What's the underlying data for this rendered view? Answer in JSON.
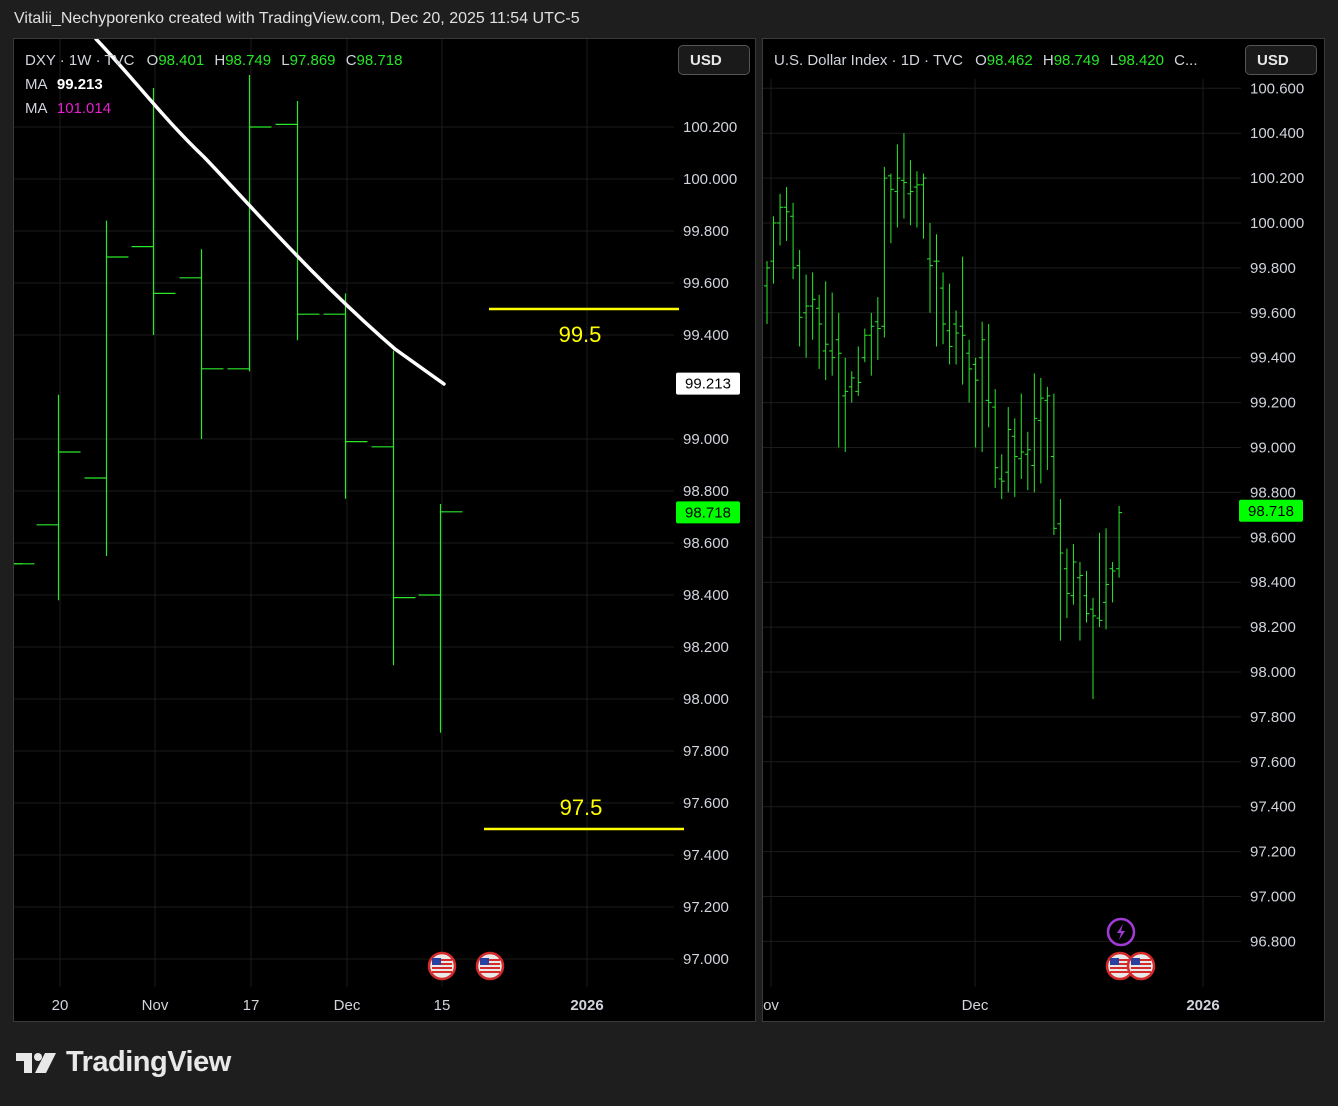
{
  "header": {
    "credit": "Vitalii_Nechyporenko created with TradingView.com, Dec 20, 2025 11:54 UTC-5"
  },
  "brand": {
    "name": "TradingView",
    "logo_icon": "tradingview-logo-icon"
  },
  "colors": {
    "bar": "#2be82b",
    "price_tag": "#00ff00",
    "ma_white": "#ffffff",
    "ma_magenta": "#e81ed0",
    "level_line": "#ffff00",
    "pane_bg": "#000000",
    "grid": "#1c1c1c"
  },
  "left_chart": {
    "legend": {
      "symbol": "DXY · 1W · TVC",
      "o_label": "O",
      "o_value": "98.401",
      "h_label": "H",
      "h_value": "98.749",
      "l_label": "L",
      "l_value": "97.869",
      "c_label": "C",
      "c_value": "98.718",
      "ma1_label": "MA",
      "ma1_value": "99.213",
      "ma2_label": "MA",
      "ma2_value": "101.014"
    },
    "currency_button": "USD",
    "ma_tag": "99.213",
    "price_tag": "98.718",
    "levels": [
      {
        "label": "99.5"
      },
      {
        "label": "97.5"
      }
    ],
    "x_labels": [
      "20",
      "Nov",
      "17",
      "Dec",
      "15",
      "2026"
    ],
    "event_icons": [
      "us-flag-icon",
      "us-flag-icon"
    ]
  },
  "right_chart": {
    "legend": {
      "symbol": "U.S. Dollar Index · 1D · TVC",
      "o_label": "O",
      "o_value": "98.462",
      "h_label": "H",
      "h_value": "98.749",
      "l_label": "L",
      "l_value": "98.420",
      "c_label": "C..."
    },
    "currency_button": "USD",
    "price_tag": "98.718",
    "x_labels": [
      "ov",
      "Dec",
      "2026"
    ],
    "event_icons": [
      "lightning-icon",
      "us-flag-icon",
      "us-flag-icon"
    ]
  },
  "chart_data": [
    {
      "type": "ohlc",
      "title": "DXY · 1W · TVC",
      "y_ticks": [
        "100.200",
        "100.000",
        "99.800",
        "99.600",
        "99.400",
        "99.000",
        "98.800",
        "98.600",
        "98.400",
        "98.200",
        "98.000",
        "97.800",
        "97.600",
        "97.400",
        "97.200",
        "97.000"
      ],
      "ylim": [
        96.9,
        100.4
      ],
      "bars": [
        {
          "o": 98.52,
          "h": 98.52,
          "l": 98.52,
          "c": 98.52
        },
        {
          "o": 98.67,
          "h": 99.17,
          "l": 98.38,
          "c": 98.95
        },
        {
          "o": 98.85,
          "h": 99.84,
          "l": 98.55,
          "c": 99.7
        },
        {
          "o": 99.74,
          "h": 100.35,
          "l": 99.4,
          "c": 99.56
        },
        {
          "o": 99.62,
          "h": 99.73,
          "l": 99.0,
          "c": 99.27
        },
        {
          "o": 99.27,
          "h": 100.4,
          "l": 99.26,
          "c": 100.2
        },
        {
          "o": 100.21,
          "h": 100.3,
          "l": 99.38,
          "c": 99.48
        },
        {
          "o": 99.48,
          "h": 99.56,
          "l": 98.77,
          "c": 98.99
        },
        {
          "o": 98.97,
          "h": 99.34,
          "l": 98.13,
          "c": 98.39
        },
        {
          "o": 98.4,
          "h": 98.75,
          "l": 97.87,
          "c": 98.72
        }
      ],
      "ma_series": [
        {
          "name": "MA",
          "value": "99.213"
        },
        {
          "name": "MA",
          "value": "101.014"
        }
      ],
      "horizontal_levels": [
        99.5,
        97.5
      ],
      "x_labels": [
        "20",
        "Nov",
        "17",
        "Dec",
        "15",
        "2026"
      ]
    },
    {
      "type": "ohlc",
      "title": "U.S. Dollar Index · 1D · TVC",
      "y_ticks": [
        "100.600",
        "100.400",
        "100.200",
        "100.000",
        "99.800",
        "99.600",
        "99.400",
        "99.200",
        "99.000",
        "98.800",
        "98.600",
        "98.400",
        "98.200",
        "98.000",
        "97.800",
        "97.600",
        "97.400",
        "97.200",
        "97.000",
        "96.800"
      ],
      "ylim": [
        96.7,
        100.6
      ],
      "bars": [
        {
          "o": 99.72,
          "h": 99.83,
          "l": 99.55,
          "c": 99.8
        },
        {
          "o": 99.83,
          "h": 100.03,
          "l": 99.73,
          "c": 100.0
        },
        {
          "o": 100.0,
          "h": 100.13,
          "l": 99.9,
          "c": 100.07
        },
        {
          "o": 100.07,
          "h": 100.16,
          "l": 99.92,
          "c": 100.05
        },
        {
          "o": 100.03,
          "h": 100.09,
          "l": 99.75,
          "c": 99.8
        },
        {
          "o": 99.81,
          "h": 99.88,
          "l": 99.45,
          "c": 99.58
        },
        {
          "o": 99.6,
          "h": 99.77,
          "l": 99.4,
          "c": 99.63
        },
        {
          "o": 99.63,
          "h": 99.78,
          "l": 99.48,
          "c": 99.66
        },
        {
          "o": 99.62,
          "h": 99.68,
          "l": 99.35,
          "c": 99.55
        },
        {
          "o": 99.43,
          "h": 99.74,
          "l": 99.3,
          "c": 99.46
        },
        {
          "o": 99.43,
          "h": 99.69,
          "l": 99.32,
          "c": 99.4
        },
        {
          "o": 99.48,
          "h": 99.6,
          "l": 99.0,
          "c": 99.42
        },
        {
          "o": 99.23,
          "h": 99.4,
          "l": 98.98,
          "c": 99.25
        },
        {
          "o": 99.27,
          "h": 99.34,
          "l": 99.2,
          "c": 99.31
        },
        {
          "o": 99.25,
          "h": 99.45,
          "l": 99.23,
          "c": 99.29
        },
        {
          "o": 99.4,
          "h": 99.53,
          "l": 99.38,
          "c": 99.5
        },
        {
          "o": 99.5,
          "h": 99.6,
          "l": 99.32,
          "c": 99.54
        },
        {
          "o": 99.56,
          "h": 99.67,
          "l": 99.39,
          "c": 99.53
        },
        {
          "o": 99.54,
          "h": 100.25,
          "l": 99.49,
          "c": 100.2
        },
        {
          "o": 100.21,
          "h": 100.22,
          "l": 99.91,
          "c": 100.15
        },
        {
          "o": 100.14,
          "h": 100.35,
          "l": 99.98,
          "c": 100.2
        },
        {
          "o": 100.19,
          "h": 100.4,
          "l": 100.02,
          "c": 100.18
        },
        {
          "o": 100.13,
          "h": 100.28,
          "l": 99.99,
          "c": 100.14
        },
        {
          "o": 100.16,
          "h": 100.23,
          "l": 99.98,
          "c": 100.17
        },
        {
          "o": 100.17,
          "h": 100.22,
          "l": 99.93,
          "c": 100.2
        },
        {
          "o": 99.84,
          "h": 100.0,
          "l": 99.6,
          "c": 99.81
        },
        {
          "o": 99.83,
          "h": 99.95,
          "l": 99.45,
          "c": 99.83
        },
        {
          "o": 99.71,
          "h": 99.78,
          "l": 99.46,
          "c": 99.55
        },
        {
          "o": 99.52,
          "h": 99.73,
          "l": 99.37,
          "c": 99.45
        },
        {
          "o": 99.55,
          "h": 99.61,
          "l": 99.37,
          "c": 99.51
        },
        {
          "o": 99.54,
          "h": 99.85,
          "l": 99.28,
          "c": 99.5
        },
        {
          "o": 99.42,
          "h": 99.48,
          "l": 99.2,
          "c": 99.35
        },
        {
          "o": 99.37,
          "h": 99.4,
          "l": 99.0,
          "c": 99.3
        },
        {
          "o": 99.4,
          "h": 99.56,
          "l": 98.98,
          "c": 99.48
        },
        {
          "o": 99.21,
          "h": 99.55,
          "l": 99.09,
          "c": 99.2
        },
        {
          "o": 99.18,
          "h": 99.26,
          "l": 98.82,
          "c": 98.91
        },
        {
          "o": 98.86,
          "h": 98.97,
          "l": 98.77,
          "c": 98.85
        },
        {
          "o": 98.89,
          "h": 99.18,
          "l": 98.8,
          "c": 99.08
        },
        {
          "o": 99.05,
          "h": 99.13,
          "l": 98.78,
          "c": 98.96
        },
        {
          "o": 98.95,
          "h": 99.24,
          "l": 98.86,
          "c": 98.98
        },
        {
          "o": 98.97,
          "h": 99.07,
          "l": 98.81,
          "c": 98.99
        },
        {
          "o": 98.92,
          "h": 99.33,
          "l": 98.8,
          "c": 99.13
        },
        {
          "o": 99.12,
          "h": 99.31,
          "l": 98.84,
          "c": 99.22
        },
        {
          "o": 99.21,
          "h": 99.27,
          "l": 98.9,
          "c": 99.23
        },
        {
          "o": 98.96,
          "h": 99.24,
          "l": 98.61,
          "c": 98.64
        },
        {
          "o": 98.66,
          "h": 98.77,
          "l": 98.14,
          "c": 98.53
        },
        {
          "o": 98.46,
          "h": 98.55,
          "l": 98.24,
          "c": 98.35
        },
        {
          "o": 98.34,
          "h": 98.57,
          "l": 98.3,
          "c": 98.49
        },
        {
          "o": 98.42,
          "h": 98.49,
          "l": 98.14,
          "c": 98.43
        },
        {
          "o": 98.34,
          "h": 98.45,
          "l": 98.22,
          "c": 98.26
        },
        {
          "o": 98.28,
          "h": 98.33,
          "l": 97.88,
          "c": 98.25
        },
        {
          "o": 98.24,
          "h": 98.62,
          "l": 98.2,
          "c": 98.23
        },
        {
          "o": 98.31,
          "h": 98.64,
          "l": 98.19,
          "c": 98.39
        },
        {
          "o": 98.46,
          "h": 98.49,
          "l": 98.31,
          "c": 98.45
        },
        {
          "o": 98.46,
          "h": 98.74,
          "l": 98.42,
          "c": 98.71
        }
      ],
      "x_labels": [
        "ov",
        "Dec",
        "2026"
      ]
    }
  ]
}
